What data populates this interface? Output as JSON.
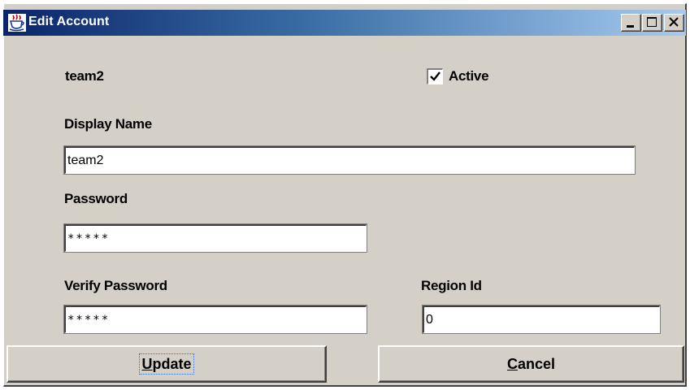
{
  "window": {
    "title": "Edit Account"
  },
  "account": {
    "name": "team2",
    "active_label": "Active",
    "active_checked": true
  },
  "fields": {
    "display_name": {
      "label": "Display Name",
      "value": "team2"
    },
    "password": {
      "label": "Password",
      "value": "*****"
    },
    "verify_password": {
      "label": "Verify Password",
      "value": "*****"
    },
    "region_id": {
      "label": "Region Id",
      "value": "0"
    }
  },
  "buttons": {
    "update": {
      "label_mnemonic": "U",
      "label_rest": "pdate"
    },
    "cancel": {
      "label_mnemonic": "C",
      "label_rest": "ancel"
    }
  },
  "icons": {
    "app": "java-cup-icon",
    "minimize": "minimize-icon",
    "maximize": "maximize-icon",
    "close": "close-icon",
    "check": "checkmark-icon"
  },
  "colors": {
    "title_gradient_start": "#0a246a",
    "title_gradient_end": "#a6caf0",
    "window_bg": "#d4d0c8",
    "field_bg": "#ffffff"
  }
}
